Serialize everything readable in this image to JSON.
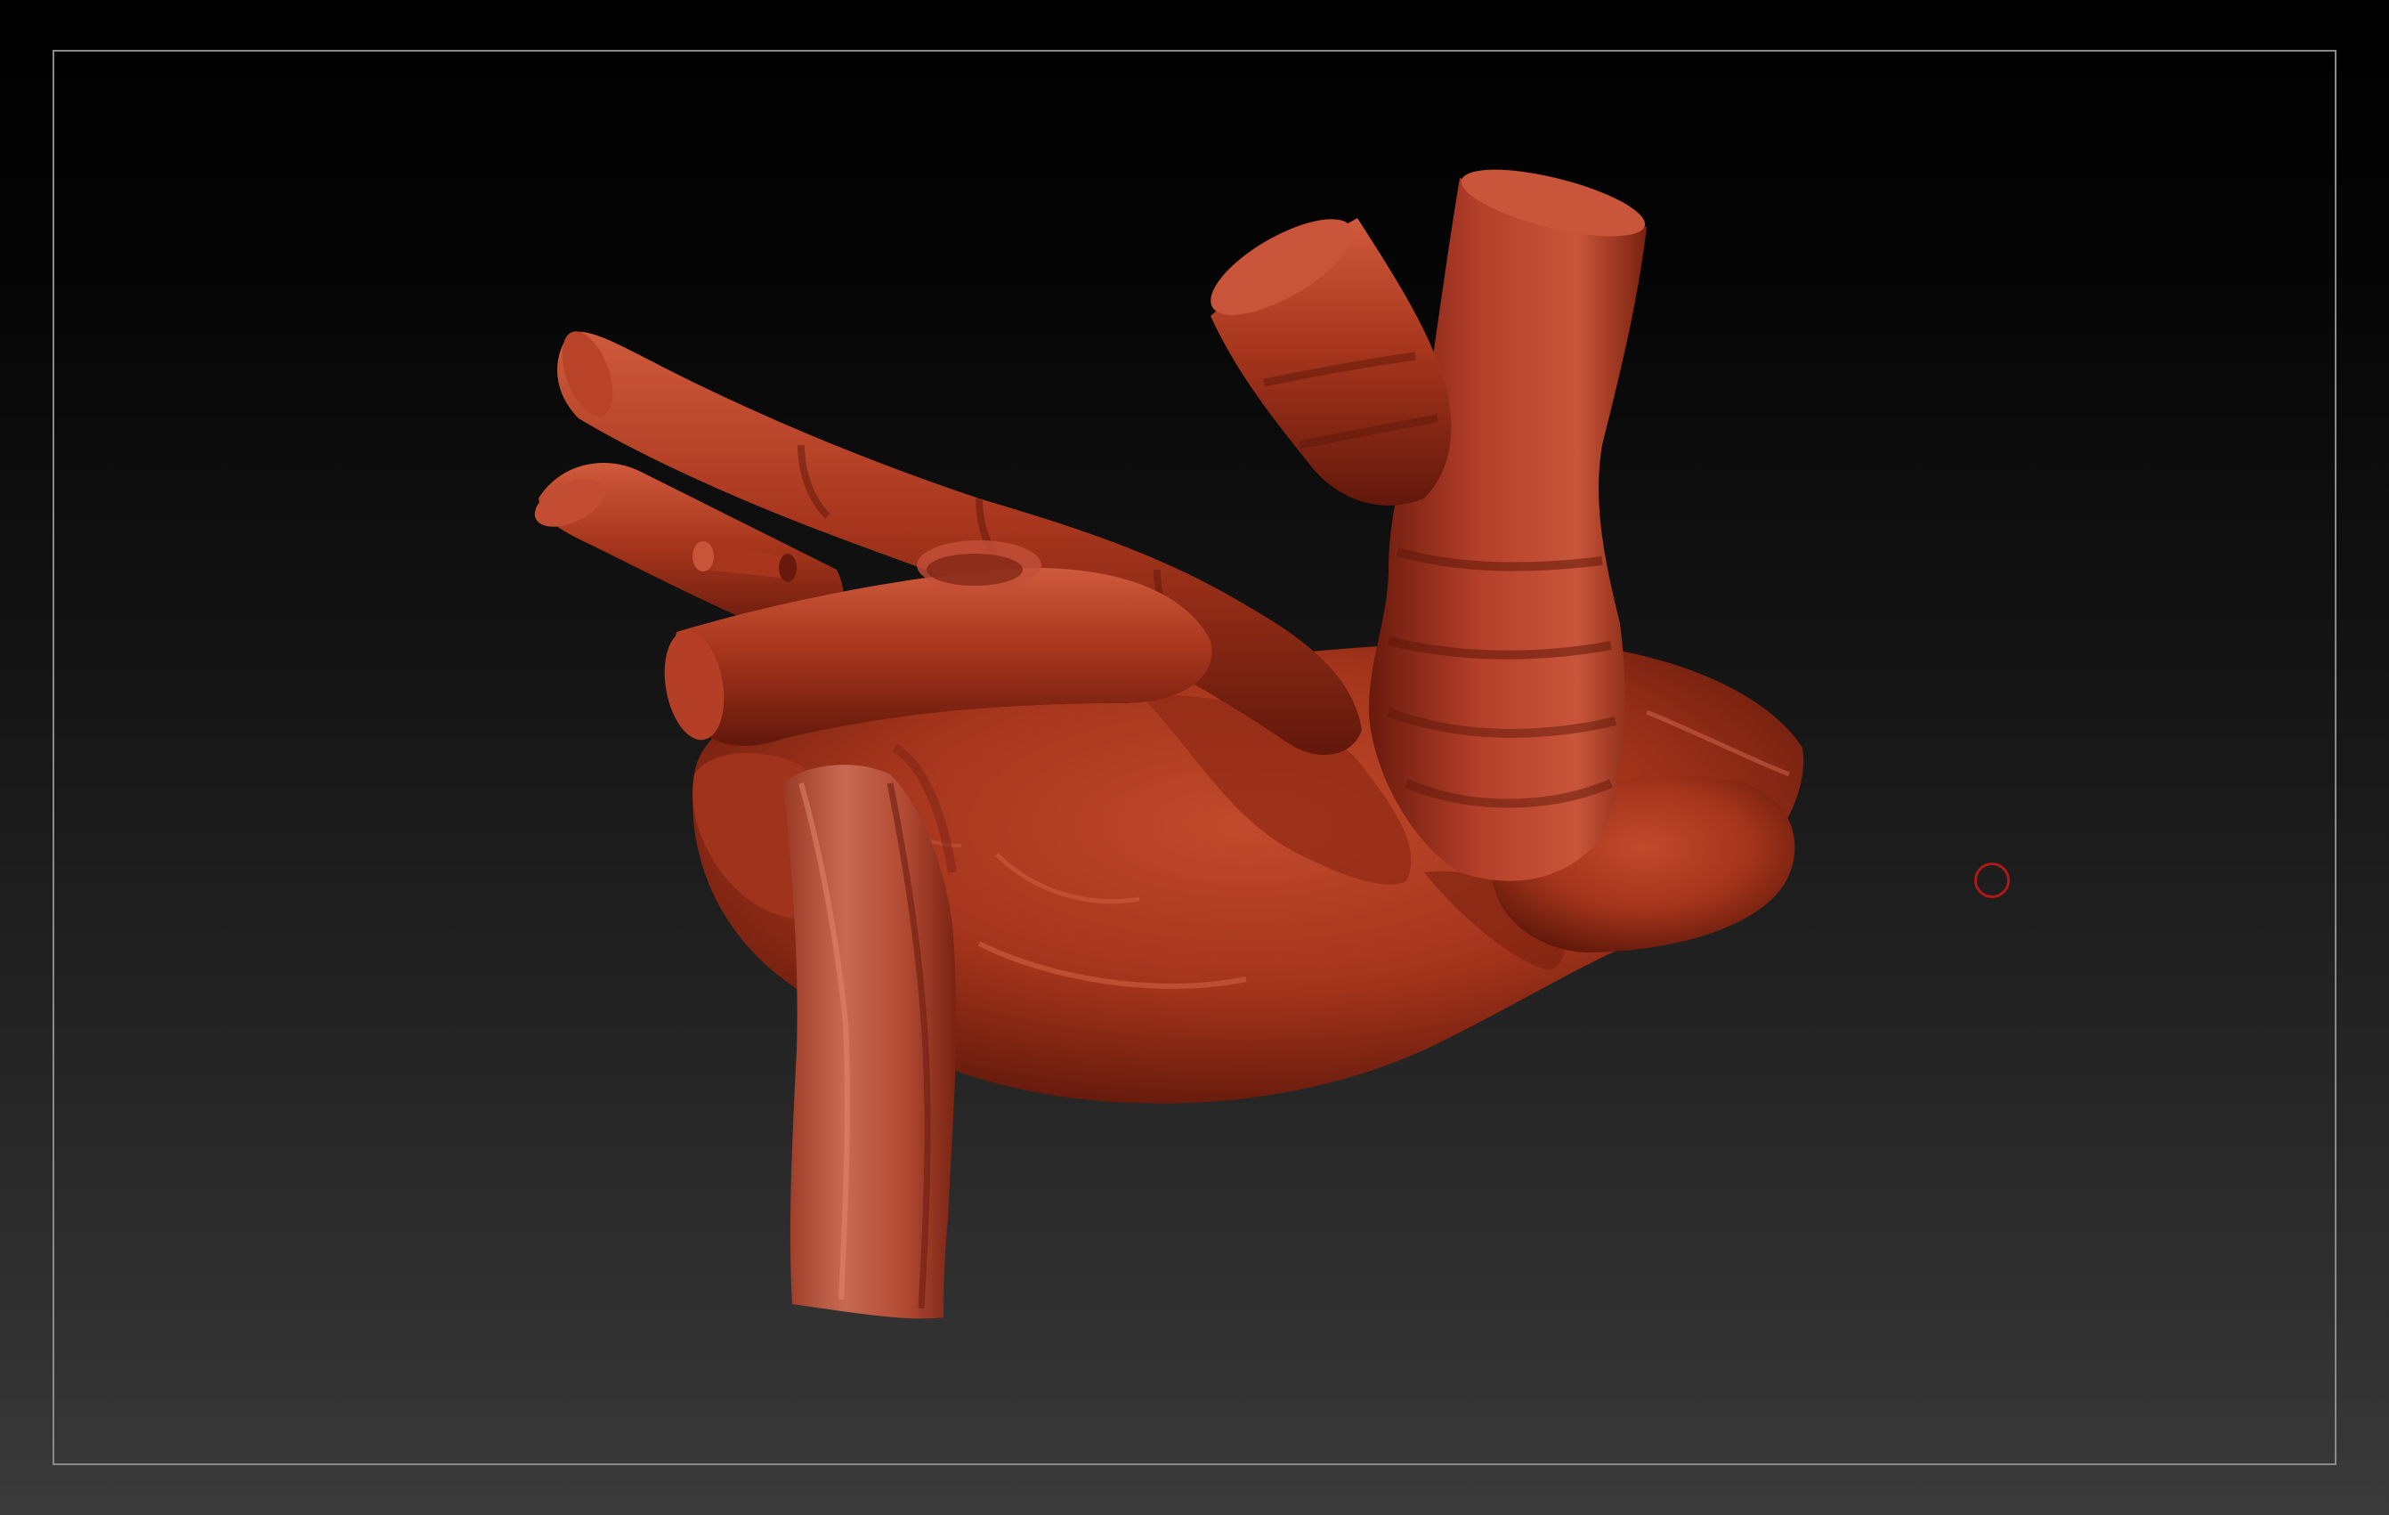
{
  "app": {
    "kind": "3D sculpting viewport"
  },
  "canvas": {
    "background_top": "#000000",
    "background_bottom": "#3a3a3a",
    "frame_color": "#8a8a8a"
  },
  "model": {
    "material_color": "#b03a22",
    "highlight_color": "#d0583a",
    "shadow_color": "#5a1408"
  },
  "cursor": {
    "icon": "brush-circle-icon",
    "color": "#b01818"
  }
}
